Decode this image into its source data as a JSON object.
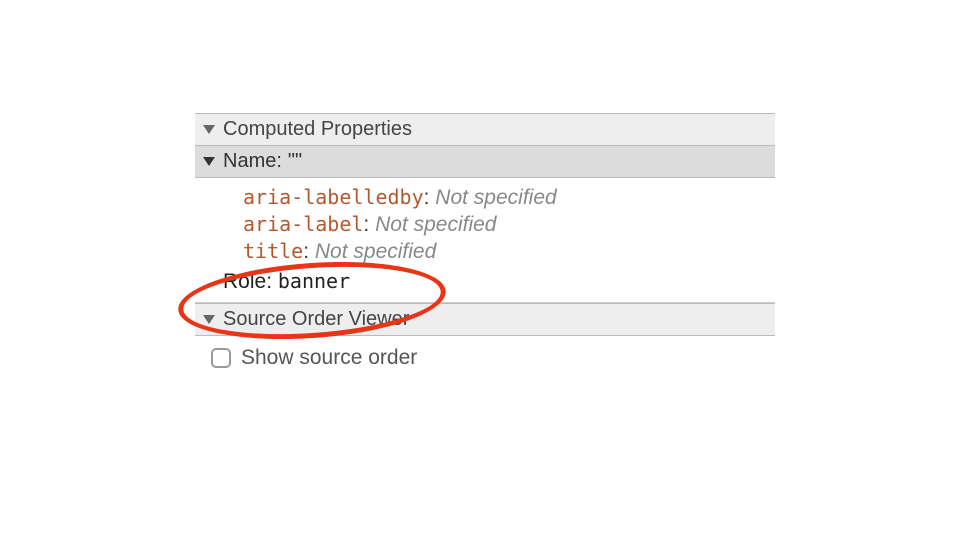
{
  "sections": {
    "computed": {
      "title": "Computed Properties"
    },
    "name": {
      "label": "Name:",
      "value": "\"\"",
      "attrs": [
        {
          "key": "aria-labelledby",
          "value": "Not specified"
        },
        {
          "key": "aria-label",
          "value": "Not specified"
        },
        {
          "key": "title",
          "value": "Not specified"
        }
      ]
    },
    "role": {
      "label": "Role:",
      "value": "banner"
    },
    "sourceOrder": {
      "title": "Source Order Viewer",
      "checkboxLabel": "Show source order"
    }
  }
}
